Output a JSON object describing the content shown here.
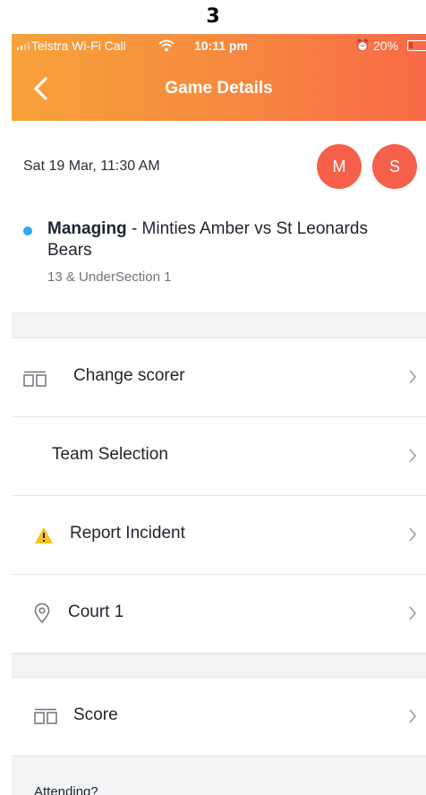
{
  "page_number": "3",
  "status_bar": {
    "carrier": "Telstra Wi-Fi Call",
    "time": "10:11 pm",
    "battery": "20%"
  },
  "nav": {
    "title": "Game Details"
  },
  "game": {
    "date": "Sat 19 Mar, 11:30 AM",
    "avatars": [
      "M",
      "S"
    ],
    "role": "Managing",
    "teams": " - Minties Amber vs St Leonards Bears",
    "division": "13 & UnderSection 1"
  },
  "menu": {
    "change_scorer": "Change scorer",
    "team_selection": "Team Selection",
    "report_incident": "Report Incident",
    "court": "Court 1",
    "score": "Score"
  },
  "attending": {
    "label": "Attending?"
  },
  "colors": {
    "header_gradient_start": "#f7a23a",
    "header_gradient_end": "#f86a48",
    "avatar": "#f5604a",
    "status_dot": "#2ba8f0",
    "warning": "#f6c21c"
  }
}
